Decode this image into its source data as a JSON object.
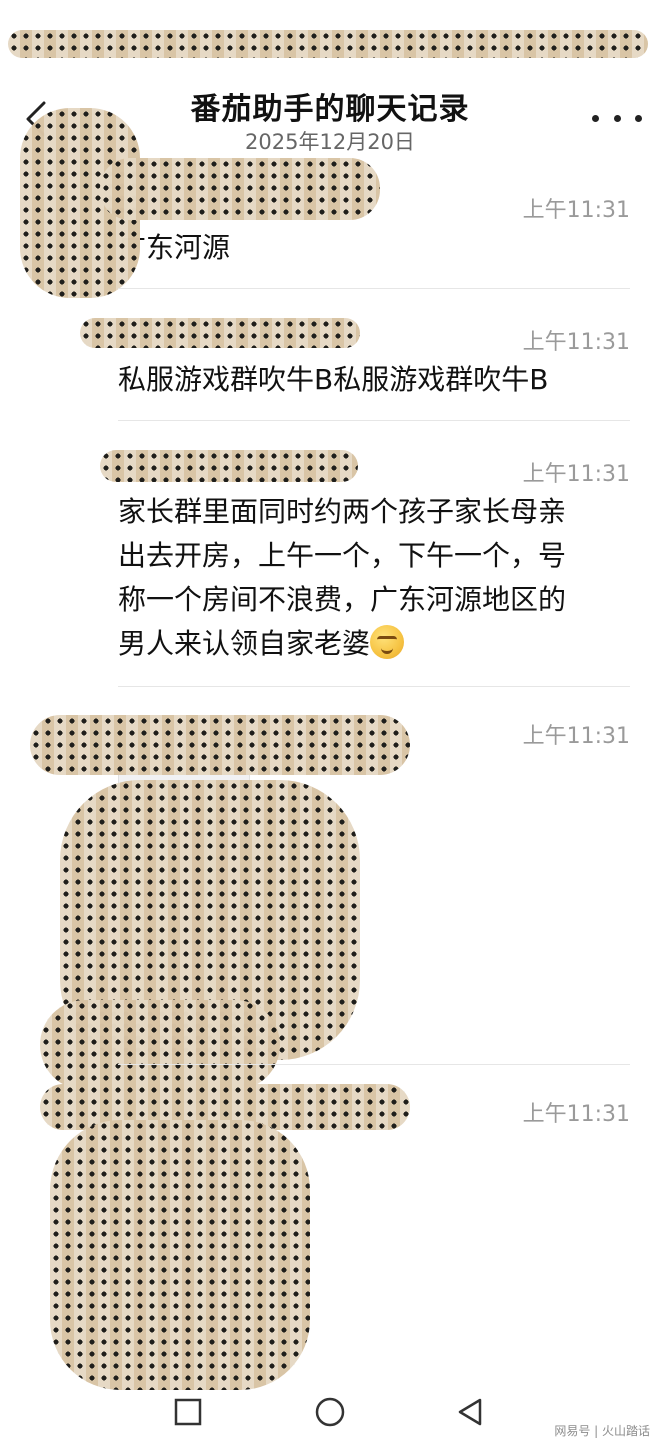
{
  "header": {
    "title": "番茄助手的聊天记录",
    "date": "2025年12月20日"
  },
  "messages": [
    {
      "time": "上午11:31",
      "text_lines": [
        "广东河源"
      ]
    },
    {
      "time": "上午11:31",
      "text_lines": [
        "私服游戏群吹牛B私服游戏群吹牛B"
      ]
    },
    {
      "time": "上午11:31",
      "text_lines": [
        "家长群里面同时约两个孩子家长母亲",
        "出去开房，上午一个，下午一个，号",
        "称一个房间不浪费，广东河源地区的",
        "男人来认领自家老婆"
      ],
      "emoji": "smirk-face-emoji"
    },
    {
      "time": "上午11:31",
      "attachment": "image"
    },
    {
      "time": "上午11:31",
      "attachment": "image"
    }
  ],
  "icons": {
    "back": "chevron-left-icon",
    "more": "more-dots-icon",
    "nav_recent": "square-icon",
    "nav_home": "circle-icon",
    "nav_back": "triangle-left-icon"
  },
  "watermark": "网易号 | 火山踏话",
  "colors": {
    "time": "#9a9a9a",
    "sender": "#b79a6a",
    "censor": "#d9c4a5"
  }
}
